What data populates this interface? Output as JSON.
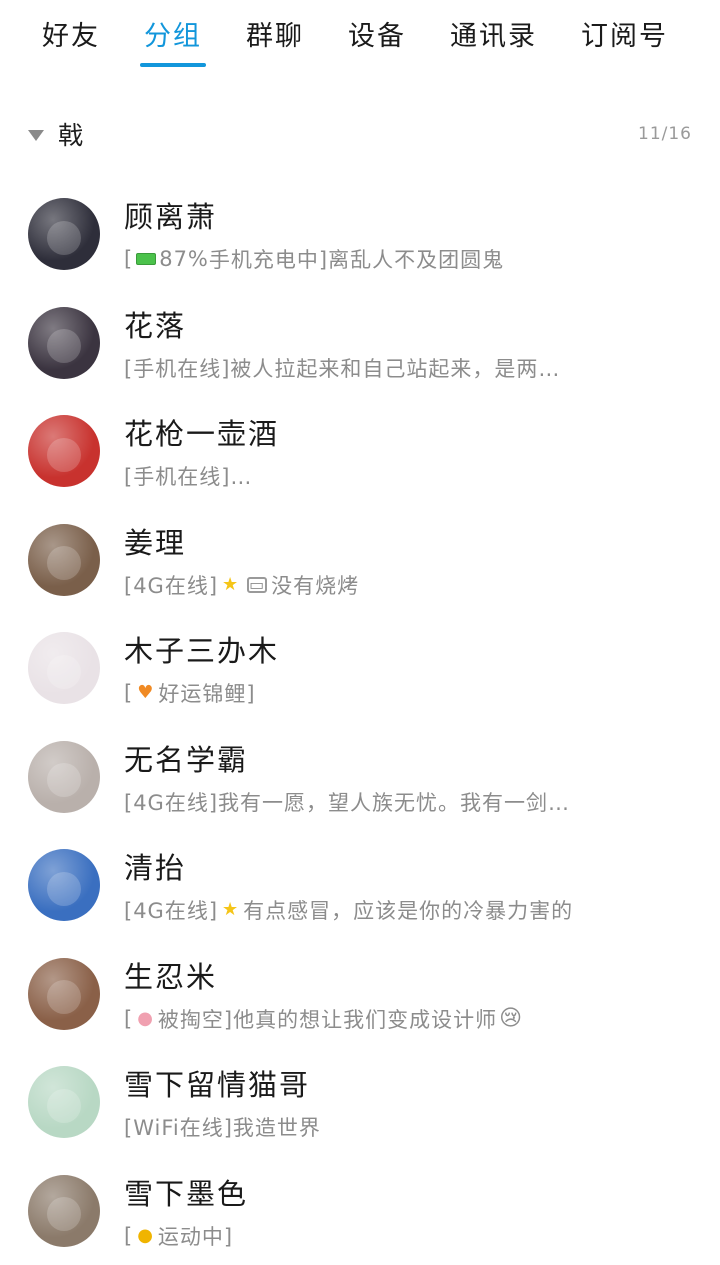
{
  "tabs": [
    {
      "label": "好友",
      "active": false
    },
    {
      "label": "分组",
      "active": true
    },
    {
      "label": "群聊",
      "active": false
    },
    {
      "label": "设备",
      "active": false
    },
    {
      "label": "通讯录",
      "active": false
    },
    {
      "label": "订阅号",
      "active": false
    }
  ],
  "accent_color": "#1296db",
  "group": {
    "name": "戟",
    "count": "11/16"
  },
  "contacts": [
    {
      "name": "顾离萧",
      "prefix": "[",
      "battery": "87%",
      "suffix": "手机充电中]离乱人不及团圆鬼",
      "avatar_color": "#2e2e3a"
    },
    {
      "name": "花落",
      "status": "[手机在线]被人拉起来和自己站起来，是两…",
      "avatar_color": "#3b3440"
    },
    {
      "name": "花枪一壶酒",
      "status": "[手机在线]…",
      "avatar_color": "#c8322e"
    },
    {
      "name": "姜理",
      "status_a": "[4G在线]",
      "icon_star": "★",
      "icon_img": "▭",
      "status_b": "没有烧烤",
      "avatar_color": "#7a5f4a"
    },
    {
      "name": "木子三办木",
      "prefix": "[",
      "icon": "♥",
      "status_b": "好运锦鲤]",
      "avatar_color": "#e9e2e6"
    },
    {
      "name": "无名学霸",
      "status": "[4G在线]我有一愿，望人族无忧。我有一剑…",
      "avatar_color": "#b9b0ab"
    },
    {
      "name": "清抬",
      "status_a": "[4G在线]",
      "icon_star": "★",
      "status_b": "有点感冒，应该是你的冷暴力害的",
      "avatar_color": "#3a6fc0"
    },
    {
      "name": "生忍米",
      "prefix": "[",
      "icon": "●",
      "status_b": "被掏空]他真的想让我们变成设计师",
      "emoji": "😢",
      "avatar_color": "#8a6048"
    },
    {
      "name": "雪下留情猫哥",
      "status": "[WiFi在线]我造世界",
      "avatar_color": "#b8d8c4"
    },
    {
      "name": "雪下墨色",
      "prefix": "[",
      "icon": "●",
      "status_b": "运动中]",
      "avatar_color": "#8b7a6a"
    }
  ]
}
